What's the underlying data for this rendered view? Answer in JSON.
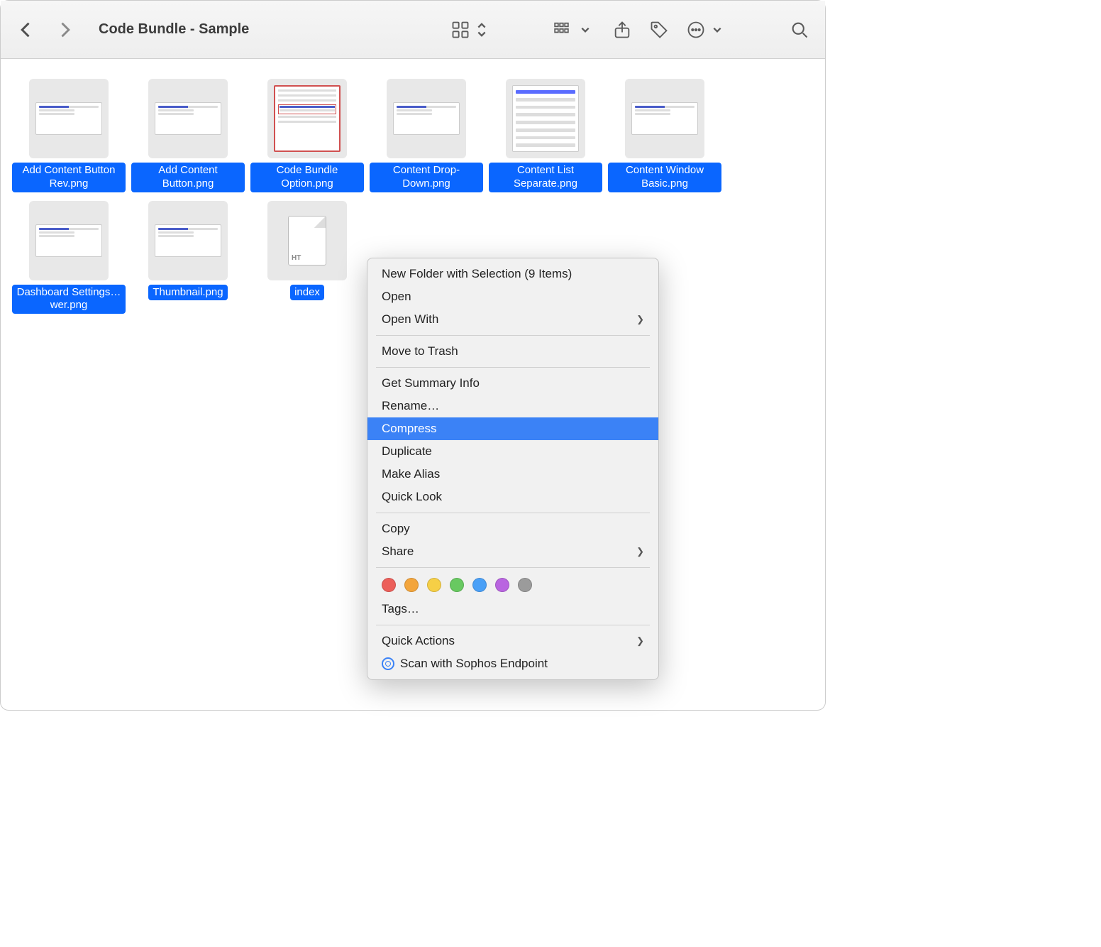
{
  "window": {
    "title": "Code Bundle - Sample"
  },
  "files": [
    {
      "label": "Add Content Button Rev.png",
      "thumb": "wide"
    },
    {
      "label": "Add Content Button.png",
      "thumb": "wide"
    },
    {
      "label": "Code Bundle Option.png",
      "thumb": "code"
    },
    {
      "label": "Content Drop-Down.png",
      "thumb": "wide"
    },
    {
      "label": "Content List Separate.png",
      "thumb": "list"
    },
    {
      "label": "Content Window Basic.png",
      "thumb": "wide"
    },
    {
      "label": "Dashboard Settings…wer.png",
      "thumb": "wide"
    },
    {
      "label": "Thumbnail.png",
      "thumb": "wide"
    },
    {
      "label": "index",
      "thumb": "doc"
    }
  ],
  "contextMenu": {
    "items": [
      {
        "label": "New Folder with Selection (9 Items)"
      },
      {
        "label": "Open"
      },
      {
        "label": "Open With",
        "submenu": true
      },
      {
        "sep": true
      },
      {
        "label": "Move to Trash"
      },
      {
        "sep": true
      },
      {
        "label": "Get Summary Info"
      },
      {
        "label": "Rename…"
      },
      {
        "label": "Compress",
        "highlighted": true
      },
      {
        "label": "Duplicate"
      },
      {
        "label": "Make Alias"
      },
      {
        "label": "Quick Look"
      },
      {
        "sep": true
      },
      {
        "label": "Copy"
      },
      {
        "label": "Share",
        "submenu": true
      },
      {
        "sep": true
      },
      {
        "tags": true
      },
      {
        "label": "Tags…"
      },
      {
        "sep": true
      },
      {
        "label": "Quick Actions",
        "submenu": true
      },
      {
        "label": "Scan with Sophos Endpoint",
        "scan": true
      }
    ],
    "tagColors": [
      "#ec5f5a",
      "#f3a53c",
      "#f6cf46",
      "#68c961",
      "#4aa0f7",
      "#b965e0",
      "#9b9b9b"
    ]
  }
}
